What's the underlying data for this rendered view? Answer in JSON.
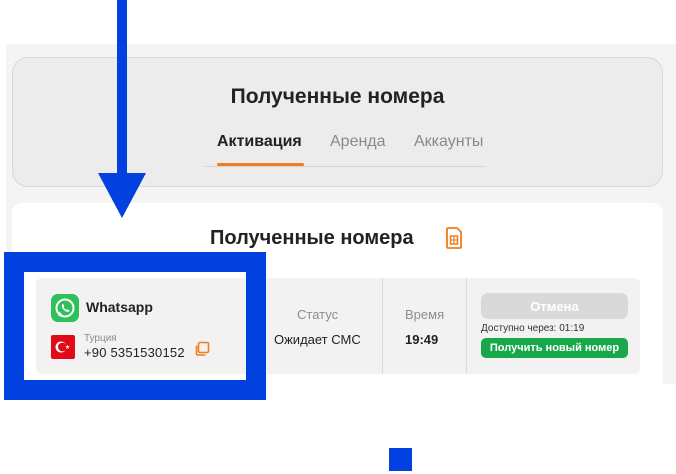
{
  "header": {
    "title": "Полученные номера",
    "tabs": [
      {
        "label": "Активация",
        "active": true
      },
      {
        "label": "Аренда",
        "active": false
      },
      {
        "label": "Аккаунты",
        "active": false
      }
    ]
  },
  "main": {
    "title": "Полученные номера",
    "table": {
      "columns": {
        "status": "Статус",
        "time": "Время"
      },
      "row": {
        "service": "Whatsapp",
        "country": "Турция",
        "phone": "+90 5351530152",
        "status": "Ожидает СМС",
        "time": "19:49",
        "cancel_label": "Отмена",
        "available_label": "Доступно через:",
        "available_time": "01:19",
        "new_number_label": "Получить новый номер"
      }
    }
  },
  "colors": {
    "accent": "#f07d1e",
    "overlay": "#0340e0",
    "whatsapp": "#2ec05a",
    "success": "#18a84a"
  },
  "icons": {
    "service": "whatsapp-icon",
    "flag": "turkey-flag-icon",
    "copy": "copy-icon",
    "title": "sim-card-icon"
  }
}
